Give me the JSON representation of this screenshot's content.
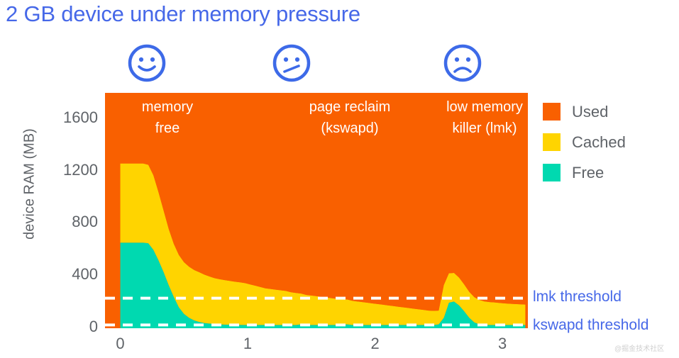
{
  "title": "2 GB device under memory pressure",
  "watermark": "@掘金技术社区",
  "faces": [
    {
      "name": "happy-face-icon",
      "mood": "happy"
    },
    {
      "name": "neutral-face-icon",
      "mood": "neutral"
    },
    {
      "name": "sad-face-icon",
      "mood": "sad"
    }
  ],
  "legend": [
    {
      "label": "Used",
      "color": "#F96000"
    },
    {
      "label": "Cached",
      "color": "#FFD400"
    },
    {
      "label": "Free",
      "color": "#00D9B0"
    }
  ],
  "thresholds": [
    {
      "label": "lmk threshold",
      "value": 230,
      "style": "dashed",
      "color": "#FFFFFF"
    },
    {
      "label": "kswapd threshold",
      "value": 25,
      "style": "dashed",
      "color": "#FFFFFF"
    }
  ],
  "colors": {
    "title": "#4668E8",
    "used": "#F96000",
    "cached": "#FFD400",
    "free": "#00D9B0",
    "axis_text": "#5F6368",
    "annotation_text": "#FFFFFF",
    "threshold_text": "#4668E8",
    "face_icon": "#3D6AE8"
  },
  "chart_data": {
    "type": "area",
    "stacked": true,
    "title": "2 GB device under memory pressure",
    "xlabel": "",
    "ylabel": "device RAM (MB)",
    "xlim": [
      -0.12,
      3.2
    ],
    "ylim": [
      0,
      1800
    ],
    "xticks": [
      0,
      1,
      2,
      3
    ],
    "xtick_labels": [
      "0",
      "1",
      "2",
      "3"
    ],
    "yticks": [
      0,
      400,
      800,
      1200,
      1600
    ],
    "ytick_labels": [
      "0",
      "400",
      "800",
      "1200",
      "1600"
    ],
    "grid": false,
    "legend_position": "right",
    "total_ram": 1800,
    "annotations": [
      {
        "text": "memory\nfree",
        "x_range": [
          0.0,
          0.55
        ],
        "face": "happy"
      },
      {
        "text": "page reclaim\n(kswapd)",
        "x_range": [
          0.7,
          2.3
        ],
        "face": "neutral"
      },
      {
        "text": "low memory\nkiller (lmk)",
        "x_range": [
          2.3,
          3.2
        ],
        "face": "sad"
      }
    ],
    "x": [
      0.0,
      0.06,
      0.12,
      0.18,
      0.22,
      0.26,
      0.3,
      0.34,
      0.38,
      0.42,
      0.46,
      0.5,
      0.54,
      0.58,
      0.62,
      0.66,
      0.7,
      0.74,
      0.78,
      0.82,
      0.86,
      0.9,
      0.94,
      0.98,
      1.02,
      1.06,
      1.1,
      1.14,
      1.18,
      1.22,
      1.26,
      1.3,
      1.34,
      1.38,
      1.42,
      1.46,
      1.5,
      1.54,
      1.58,
      1.62,
      1.66,
      1.7,
      1.74,
      1.78,
      1.82,
      1.86,
      1.9,
      1.94,
      1.98,
      2.02,
      2.06,
      2.1,
      2.14,
      2.18,
      2.22,
      2.26,
      2.3,
      2.34,
      2.38,
      2.42,
      2.46,
      2.5,
      2.54,
      2.58,
      2.62,
      2.66,
      2.7,
      2.74,
      2.78,
      2.82,
      2.86,
      2.9,
      2.94,
      2.98,
      3.02,
      3.06,
      3.1,
      3.14,
      3.18
    ],
    "series": [
      {
        "name": "Free",
        "color": "#00D9B0",
        "values": [
          655,
          655,
          655,
          655,
          650,
          600,
          520,
          430,
          330,
          240,
          160,
          110,
          80,
          60,
          48,
          40,
          36,
          33,
          30,
          28,
          27,
          26,
          26,
          25,
          25,
          25,
          25,
          25,
          25,
          25,
          25,
          25,
          25,
          25,
          30,
          25,
          25,
          25,
          25,
          25,
          25,
          25,
          25,
          30,
          25,
          25,
          25,
          25,
          25,
          25,
          25,
          25,
          25,
          25,
          25,
          25,
          25,
          25,
          25,
          25,
          25,
          30,
          80,
          195,
          205,
          175,
          130,
          80,
          45,
          30,
          25,
          25,
          25,
          25,
          25,
          25,
          25,
          25,
          25
        ]
      },
      {
        "name": "Cached",
        "color": "#FFD400",
        "values": [
          605,
          605,
          605,
          605,
          600,
          570,
          520,
          470,
          430,
          405,
          400,
          395,
          390,
          385,
          380,
          370,
          360,
          350,
          345,
          340,
          335,
          330,
          325,
          320,
          310,
          300,
          290,
          280,
          275,
          270,
          265,
          260,
          250,
          245,
          235,
          230,
          225,
          220,
          215,
          210,
          205,
          200,
          195,
          190,
          185,
          180,
          175,
          170,
          165,
          160,
          155,
          150,
          145,
          140,
          135,
          130,
          125,
          120,
          115,
          110,
          108,
          105,
          250,
          225,
          218,
          212,
          205,
          198,
          192,
          186,
          180,
          175,
          172,
          168,
          165,
          162,
          160,
          158,
          156
        ]
      },
      {
        "name": "Used",
        "color": "#F96000",
        "values": [
          540,
          540,
          540,
          540,
          550,
          630,
          760,
          900,
          1040,
          1155,
          1240,
          1295,
          1330,
          1355,
          1372,
          1390,
          1404,
          1417,
          1425,
          1432,
          1438,
          1444,
          1449,
          1455,
          1465,
          1475,
          1485,
          1495,
          1500,
          1505,
          1510,
          1515,
          1525,
          1530,
          1535,
          1545,
          1550,
          1555,
          1560,
          1565,
          1570,
          1575,
          1580,
          1580,
          1590,
          1595,
          1600,
          1605,
          1610,
          1615,
          1620,
          1625,
          1630,
          1635,
          1640,
          1645,
          1650,
          1655,
          1660,
          1665,
          1667,
          1665,
          1470,
          1380,
          1377,
          1413,
          1465,
          1522,
          1563,
          1584,
          1595,
          1600,
          1603,
          1607,
          1610,
          1613,
          1615,
          1617,
          1619
        ]
      }
    ]
  }
}
